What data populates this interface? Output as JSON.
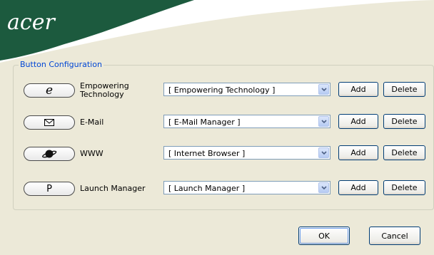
{
  "logo": "acer",
  "group_title": "Button Configuration",
  "rows": [
    {
      "icon": "empowering-e-icon",
      "label": "Empowering Technology",
      "selected": "[ Empowering Technology ]",
      "add": "Add",
      "delete": "Delete"
    },
    {
      "icon": "mail-envelope-icon",
      "label": "E-Mail",
      "selected": "[ E-Mail Manager ]",
      "add": "Add",
      "delete": "Delete"
    },
    {
      "icon": "browser-planet-icon",
      "label": "WWW",
      "selected": "[ Internet Browser ]",
      "add": "Add",
      "delete": "Delete"
    },
    {
      "icon": "letter-p-icon",
      "label": "Launch Manager",
      "selected": "[ Launch Manager ]",
      "add": "Add",
      "delete": "Delete",
      "pill_text": "P"
    }
  ],
  "footer": {
    "ok": "OK",
    "cancel": "Cancel"
  },
  "colors": {
    "header": "#1c5a3e",
    "group_title": "#0046d5",
    "button_border": "#003c74"
  }
}
